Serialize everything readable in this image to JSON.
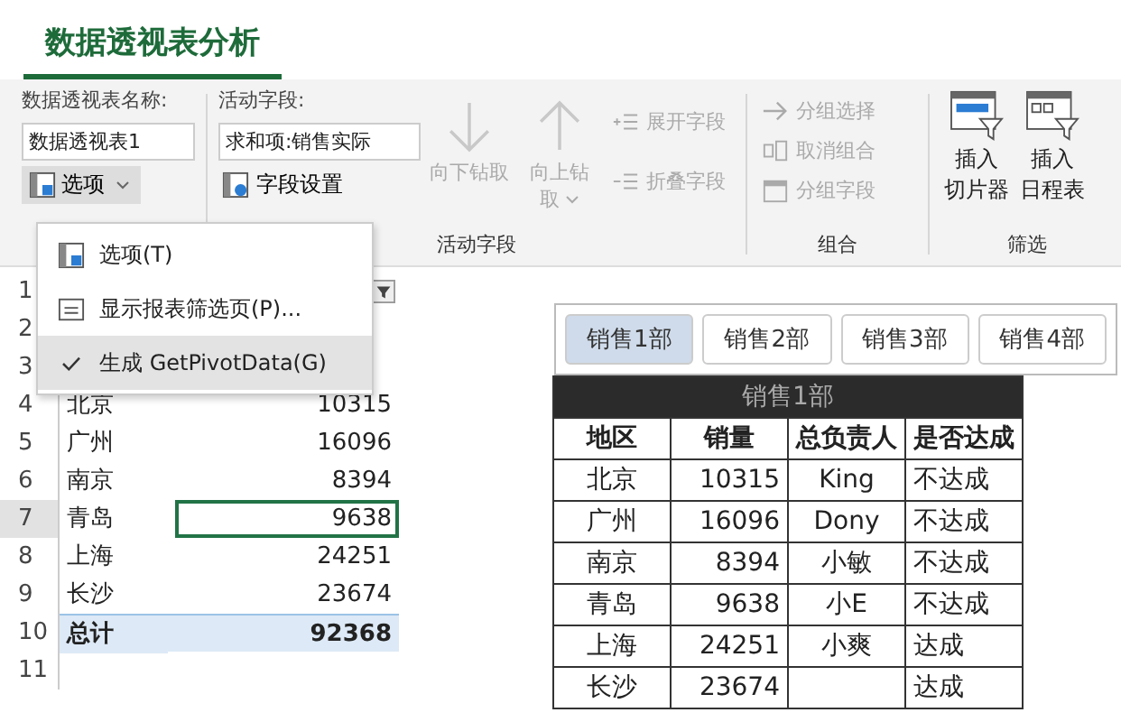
{
  "ribbon_tab": {
    "label": "数据透视表分析",
    "selected": true
  },
  "pivot_name": {
    "label": "数据透视表名称:",
    "value": "数据透视表1",
    "options_button": "选项"
  },
  "active_field": {
    "label": "活动字段:",
    "value": "求和项:销售实际",
    "settings_button": "字段设置",
    "group_label": "活动字段"
  },
  "drill_buttons": [
    {
      "line1": "向下钻取",
      "caret": false
    },
    {
      "line1": "向上钻",
      "line2": "取",
      "caret": true
    }
  ],
  "field_buttons": [
    {
      "kind": "expand",
      "label": "展开字段"
    },
    {
      "kind": "collapse",
      "label": "折叠字段"
    }
  ],
  "group": {
    "label": "组合",
    "buttons": [
      {
        "kind": "arrow",
        "label": "分组选择"
      },
      {
        "kind": "ungroup",
        "label": "取消组合"
      },
      {
        "kind": "calendar",
        "label": "分组字段"
      }
    ]
  },
  "filter": {
    "label": "筛选",
    "buttons": [
      {
        "kind": "slicer",
        "line1": "插入",
        "line2": "切片器"
      },
      {
        "kind": "timeline",
        "line1": "插入",
        "line2": "日程表"
      }
    ]
  },
  "options_menu": [
    {
      "kind": "options",
      "label": "选项(T)",
      "checked": false
    },
    {
      "kind": "report",
      "label": "显示报表筛选页(P)...",
      "checked": false
    },
    {
      "kind": "check",
      "label": "生成 GetPivotData(G)",
      "checked": true
    }
  ],
  "sheet_rows": [
    {
      "num": "1",
      "city": "",
      "value": "",
      "kind": "filter"
    },
    {
      "num": "2",
      "city": "",
      "value": "",
      "kind": "plain"
    },
    {
      "num": "3",
      "city": "",
      "value": "",
      "kind": "plain"
    },
    {
      "num": "4",
      "city": "北京",
      "value": "10315",
      "kind": "plain"
    },
    {
      "num": "5",
      "city": "广州",
      "value": "16096",
      "kind": "plain"
    },
    {
      "num": "6",
      "city": "南京",
      "value": "8394",
      "kind": "plain"
    },
    {
      "num": "7",
      "city": "青岛",
      "value": "9638",
      "kind": "active"
    },
    {
      "num": "8",
      "city": "上海",
      "value": "24251",
      "kind": "plain"
    },
    {
      "num": "9",
      "city": "长沙",
      "value": "23674",
      "kind": "plain"
    },
    {
      "num": "10",
      "city": "总计",
      "value": "92368",
      "kind": "total"
    },
    {
      "num": "11",
      "city": "",
      "value": "",
      "kind": "plain"
    }
  ],
  "slicer": [
    {
      "label": "销售1部",
      "selected": true
    },
    {
      "label": "销售2部",
      "selected": false
    },
    {
      "label": "销售3部",
      "selected": false
    },
    {
      "label": "销售4部",
      "selected": false
    }
  ],
  "sales_table": {
    "title": "销售1部",
    "columns": [
      "地区",
      "销量",
      "总负责人",
      "是否达成"
    ],
    "rows": [
      [
        "北京",
        "10315",
        "King",
        "不达成"
      ],
      [
        "广州",
        "16096",
        "Dony",
        "不达成"
      ],
      [
        "南京",
        "8394",
        "小敏",
        "不达成"
      ],
      [
        "青岛",
        "9638",
        "小E",
        "不达成"
      ],
      [
        "上海",
        "24251",
        "小爽",
        "达成"
      ],
      [
        "长沙",
        "23674",
        "",
        "达成"
      ]
    ]
  }
}
